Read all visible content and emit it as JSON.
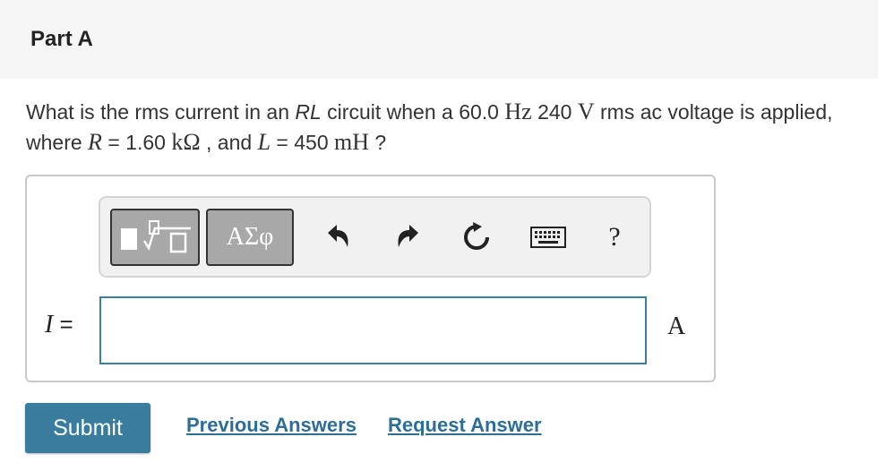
{
  "header": {
    "title": "Part A"
  },
  "question": {
    "t1": "What is the rms current in an ",
    "t2": "RL",
    "t3": " circuit when a 60.0 ",
    "u_hz": "Hz",
    "t4": " 240 ",
    "u_v": "V",
    "t5": " rms ac voltage is applied, where ",
    "var_r": "R",
    "t6": " = 1.60 ",
    "u_kohm": "kΩ",
    "t7": " , and ",
    "var_l": "L",
    "t8": " = 450 ",
    "u_mh": "mH",
    "t9": " ?"
  },
  "toolbar": {
    "templates_icon": "templates-icon",
    "symbols_label": "ΑΣφ",
    "undo_icon": "undo-icon",
    "redo_icon": "redo-icon",
    "reset_icon": "reset-icon",
    "keyboard_icon": "keyboard-icon",
    "help_label": "?"
  },
  "answer": {
    "variable": "I",
    "equals": " =",
    "value": "",
    "unit": "A"
  },
  "actions": {
    "submit_label": "Submit",
    "previous_answers_label": "Previous Answers",
    "request_answer_label": "Request Answer"
  },
  "colors": {
    "accent": "#3a7c9e",
    "link": "#2d6e96",
    "input_border": "#3a7fa6",
    "header_bg": "#f5f5f5"
  }
}
